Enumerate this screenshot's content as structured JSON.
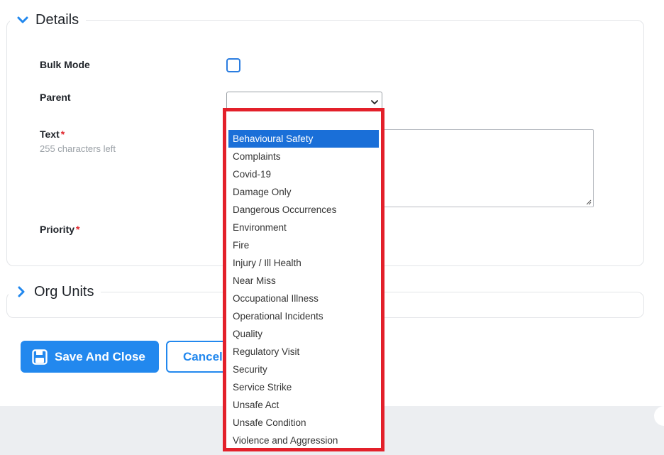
{
  "details": {
    "legend": "Details",
    "fields": {
      "bulk_mode": {
        "label": "Bulk Mode",
        "checked": false
      },
      "parent": {
        "label": "Parent",
        "value": ""
      },
      "text": {
        "label": "Text",
        "required_mark": "*",
        "hint": "255 characters left",
        "value": ""
      },
      "priority": {
        "label": "Priority",
        "required_mark": "*"
      }
    }
  },
  "org_units": {
    "legend": "Org Units"
  },
  "buttons": {
    "save": "Save And Close",
    "cancel": "Cancel"
  },
  "dropdown": {
    "selected": "Behavioural Safety",
    "options": [
      "Behavioural Safety",
      "Complaints",
      "Covid-19",
      "Damage Only",
      "Dangerous Occurrences",
      "Environment",
      "Fire",
      "Injury / Ill Health",
      "Near Miss",
      "Occupational Illness",
      "Operational Incidents",
      "Quality",
      "Regulatory Visit",
      "Security",
      "Service Strike",
      "Unsafe Act",
      "Unsafe Condition",
      "Violence and Aggression"
    ]
  },
  "colors": {
    "accent": "#2288ee",
    "highlight_frame": "#e3202a",
    "selected_option": "#1a6fd8",
    "required": "#e0262d"
  }
}
